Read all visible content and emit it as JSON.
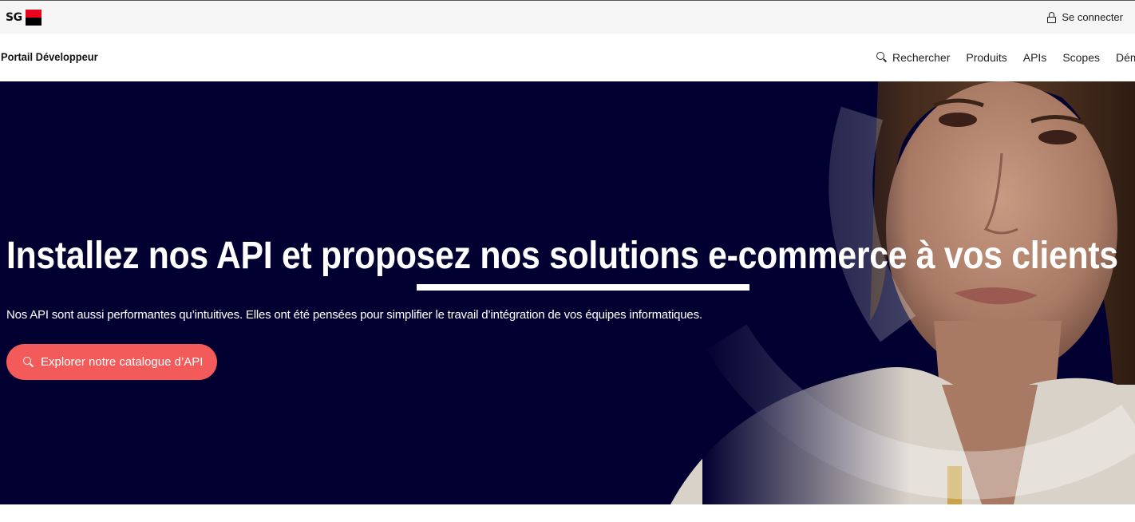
{
  "topbar": {
    "logo_text": "SG",
    "connect_label": "Se connecter"
  },
  "navbar": {
    "portal_title": "Portail Développeur",
    "items": [
      {
        "label": "Rechercher",
        "icon": "search-icon"
      },
      {
        "label": "Produits"
      },
      {
        "label": "APIs"
      },
      {
        "label": "Scopes"
      },
      {
        "label": "Dém"
      }
    ]
  },
  "hero": {
    "title": "Installez nos API et proposez nos solutions e-commerce à vos clients",
    "subtitle": "Nos API sont aussi performantes qu’intuitives. Elles ont été pensées pour simplifier le travail d’intégration de vos équipes informatiques.",
    "cta_label": "Explorer notre catalogue d’API",
    "cta_icon": "search-icon"
  },
  "colors": {
    "hero_bg": "#010030",
    "cta_bg": "#f35a5a",
    "brand_red": "#e9041e",
    "brand_black": "#000000"
  }
}
